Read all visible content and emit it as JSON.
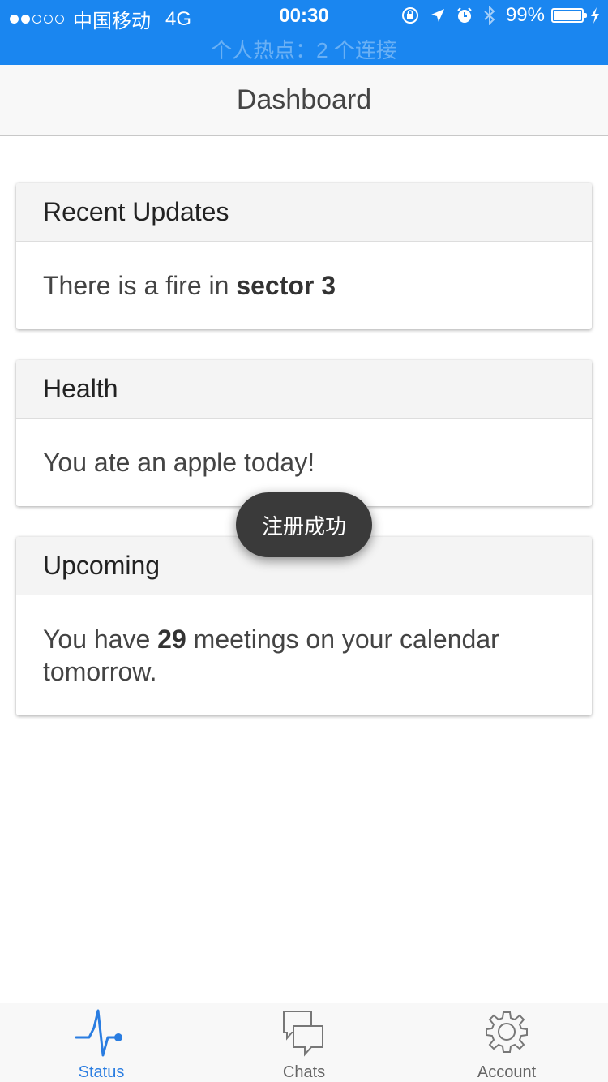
{
  "status_bar": {
    "carrier": "中国移动",
    "network": "4G",
    "time": "00:30",
    "battery": "99%",
    "hotspot": "个人热点：2 个连接",
    "signal_bars_filled": 2,
    "signal_bars_total": 5
  },
  "nav": {
    "title": "Dashboard"
  },
  "cards": [
    {
      "header": "Recent Updates",
      "text_before": "There is a fire in ",
      "bold": "sector 3",
      "text_after": ""
    },
    {
      "header": "Health",
      "text_before": "You ate an apple today!",
      "bold": "",
      "text_after": ""
    },
    {
      "header": "Upcoming",
      "text_before": "You have ",
      "bold": "29",
      "text_after": " meetings on your calendar tomorrow."
    }
  ],
  "toast": {
    "text": "注册成功"
  },
  "tabs": [
    {
      "label": "Status",
      "icon": "pulse-icon",
      "active": true
    },
    {
      "label": "Chats",
      "icon": "chat-bubbles-icon",
      "active": false
    },
    {
      "label": "Account",
      "icon": "gear-icon",
      "active": false
    }
  ],
  "colors": {
    "status_bar": "#1a86f0",
    "active_tab": "#2a7de1",
    "inactive_tab": "#666666"
  }
}
